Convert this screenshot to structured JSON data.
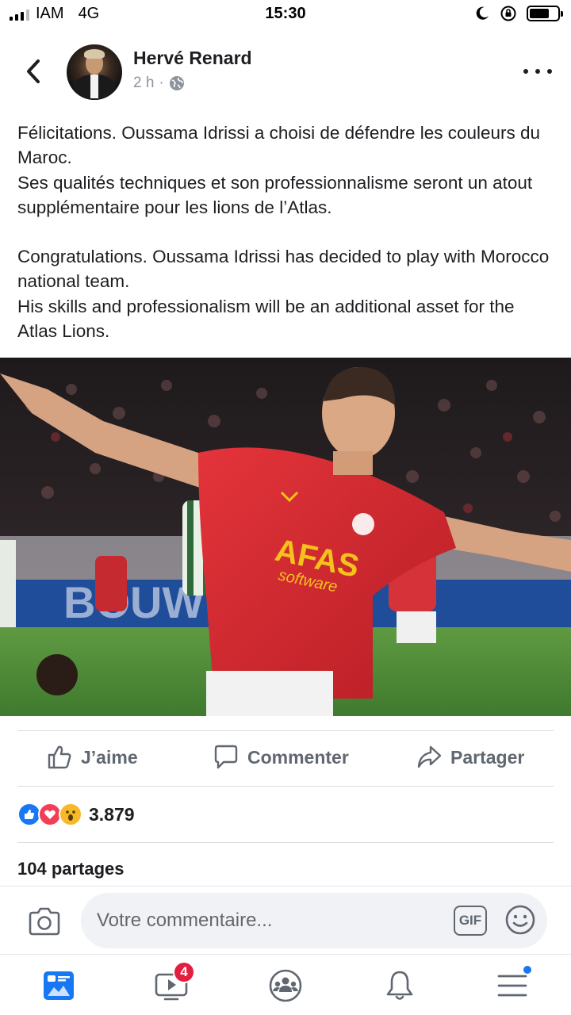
{
  "status_bar": {
    "carrier": "IAM",
    "network": "4G",
    "time": "15:30"
  },
  "post": {
    "author": "Hervé Renard",
    "time_ago": "2 h",
    "separator": "·",
    "visibility_icon": "globe-icon",
    "paragraphs_fr": [
      "Félicitations. Oussama Idrissi a choisi de défendre les couleurs du Maroc.",
      "Ses qualités techniques et son professionnalisme seront un atout supplémentaire pour les lions de l’Atlas."
    ],
    "paragraphs_en": [
      "Congratulations. Oussama Idrissi has decided to play with Morocco national team.",
      "His skills and professionalism will be an additional asset for the Atlas Lions."
    ],
    "photo": {
      "jersey_text_1": "AFAS",
      "jersey_text_2": "software",
      "board_text": "BOUW"
    }
  },
  "actions": {
    "like": "J’aime",
    "comment": "Commenter",
    "share": "Partager"
  },
  "reactions": {
    "types": [
      "like",
      "love",
      "wow"
    ],
    "count": "3.879"
  },
  "shares": "104 partages",
  "comment_box": {
    "placeholder": "Votre commentaire...",
    "gif_label": "GIF"
  },
  "bottom_nav": {
    "watch_badge": "4",
    "items": [
      "news-feed",
      "watch",
      "groups",
      "notifications",
      "menu"
    ]
  },
  "colors": {
    "accent": "#1877f2",
    "badge": "#e41e3f",
    "text": "#1c1e21",
    "muted": "#606770"
  }
}
